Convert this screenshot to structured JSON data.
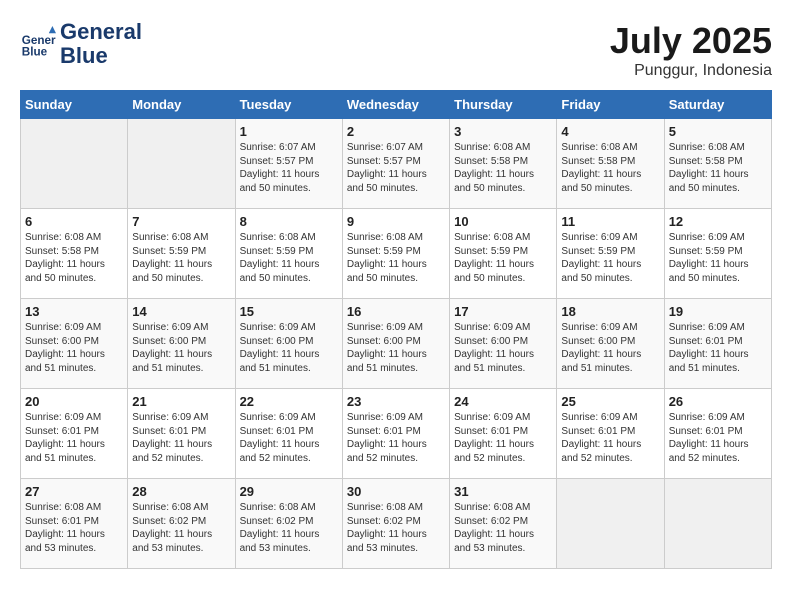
{
  "logo": {
    "line1": "General",
    "line2": "Blue"
  },
  "title": "July 2025",
  "subtitle": "Punggur, Indonesia",
  "weekdays": [
    "Sunday",
    "Monday",
    "Tuesday",
    "Wednesday",
    "Thursday",
    "Friday",
    "Saturday"
  ],
  "weeks": [
    [
      {
        "day": "",
        "info": ""
      },
      {
        "day": "",
        "info": ""
      },
      {
        "day": "1",
        "info": "Sunrise: 6:07 AM\nSunset: 5:57 PM\nDaylight: 11 hours and 50 minutes."
      },
      {
        "day": "2",
        "info": "Sunrise: 6:07 AM\nSunset: 5:57 PM\nDaylight: 11 hours and 50 minutes."
      },
      {
        "day": "3",
        "info": "Sunrise: 6:08 AM\nSunset: 5:58 PM\nDaylight: 11 hours and 50 minutes."
      },
      {
        "day": "4",
        "info": "Sunrise: 6:08 AM\nSunset: 5:58 PM\nDaylight: 11 hours and 50 minutes."
      },
      {
        "day": "5",
        "info": "Sunrise: 6:08 AM\nSunset: 5:58 PM\nDaylight: 11 hours and 50 minutes."
      }
    ],
    [
      {
        "day": "6",
        "info": "Sunrise: 6:08 AM\nSunset: 5:58 PM\nDaylight: 11 hours and 50 minutes."
      },
      {
        "day": "7",
        "info": "Sunrise: 6:08 AM\nSunset: 5:59 PM\nDaylight: 11 hours and 50 minutes."
      },
      {
        "day": "8",
        "info": "Sunrise: 6:08 AM\nSunset: 5:59 PM\nDaylight: 11 hours and 50 minutes."
      },
      {
        "day": "9",
        "info": "Sunrise: 6:08 AM\nSunset: 5:59 PM\nDaylight: 11 hours and 50 minutes."
      },
      {
        "day": "10",
        "info": "Sunrise: 6:08 AM\nSunset: 5:59 PM\nDaylight: 11 hours and 50 minutes."
      },
      {
        "day": "11",
        "info": "Sunrise: 6:09 AM\nSunset: 5:59 PM\nDaylight: 11 hours and 50 minutes."
      },
      {
        "day": "12",
        "info": "Sunrise: 6:09 AM\nSunset: 5:59 PM\nDaylight: 11 hours and 50 minutes."
      }
    ],
    [
      {
        "day": "13",
        "info": "Sunrise: 6:09 AM\nSunset: 6:00 PM\nDaylight: 11 hours and 51 minutes."
      },
      {
        "day": "14",
        "info": "Sunrise: 6:09 AM\nSunset: 6:00 PM\nDaylight: 11 hours and 51 minutes."
      },
      {
        "day": "15",
        "info": "Sunrise: 6:09 AM\nSunset: 6:00 PM\nDaylight: 11 hours and 51 minutes."
      },
      {
        "day": "16",
        "info": "Sunrise: 6:09 AM\nSunset: 6:00 PM\nDaylight: 11 hours and 51 minutes."
      },
      {
        "day": "17",
        "info": "Sunrise: 6:09 AM\nSunset: 6:00 PM\nDaylight: 11 hours and 51 minutes."
      },
      {
        "day": "18",
        "info": "Sunrise: 6:09 AM\nSunset: 6:00 PM\nDaylight: 11 hours and 51 minutes."
      },
      {
        "day": "19",
        "info": "Sunrise: 6:09 AM\nSunset: 6:01 PM\nDaylight: 11 hours and 51 minutes."
      }
    ],
    [
      {
        "day": "20",
        "info": "Sunrise: 6:09 AM\nSunset: 6:01 PM\nDaylight: 11 hours and 51 minutes."
      },
      {
        "day": "21",
        "info": "Sunrise: 6:09 AM\nSunset: 6:01 PM\nDaylight: 11 hours and 52 minutes."
      },
      {
        "day": "22",
        "info": "Sunrise: 6:09 AM\nSunset: 6:01 PM\nDaylight: 11 hours and 52 minutes."
      },
      {
        "day": "23",
        "info": "Sunrise: 6:09 AM\nSunset: 6:01 PM\nDaylight: 11 hours and 52 minutes."
      },
      {
        "day": "24",
        "info": "Sunrise: 6:09 AM\nSunset: 6:01 PM\nDaylight: 11 hours and 52 minutes."
      },
      {
        "day": "25",
        "info": "Sunrise: 6:09 AM\nSunset: 6:01 PM\nDaylight: 11 hours and 52 minutes."
      },
      {
        "day": "26",
        "info": "Sunrise: 6:09 AM\nSunset: 6:01 PM\nDaylight: 11 hours and 52 minutes."
      }
    ],
    [
      {
        "day": "27",
        "info": "Sunrise: 6:08 AM\nSunset: 6:01 PM\nDaylight: 11 hours and 53 minutes."
      },
      {
        "day": "28",
        "info": "Sunrise: 6:08 AM\nSunset: 6:02 PM\nDaylight: 11 hours and 53 minutes."
      },
      {
        "day": "29",
        "info": "Sunrise: 6:08 AM\nSunset: 6:02 PM\nDaylight: 11 hours and 53 minutes."
      },
      {
        "day": "30",
        "info": "Sunrise: 6:08 AM\nSunset: 6:02 PM\nDaylight: 11 hours and 53 minutes."
      },
      {
        "day": "31",
        "info": "Sunrise: 6:08 AM\nSunset: 6:02 PM\nDaylight: 11 hours and 53 minutes."
      },
      {
        "day": "",
        "info": ""
      },
      {
        "day": "",
        "info": ""
      }
    ]
  ]
}
